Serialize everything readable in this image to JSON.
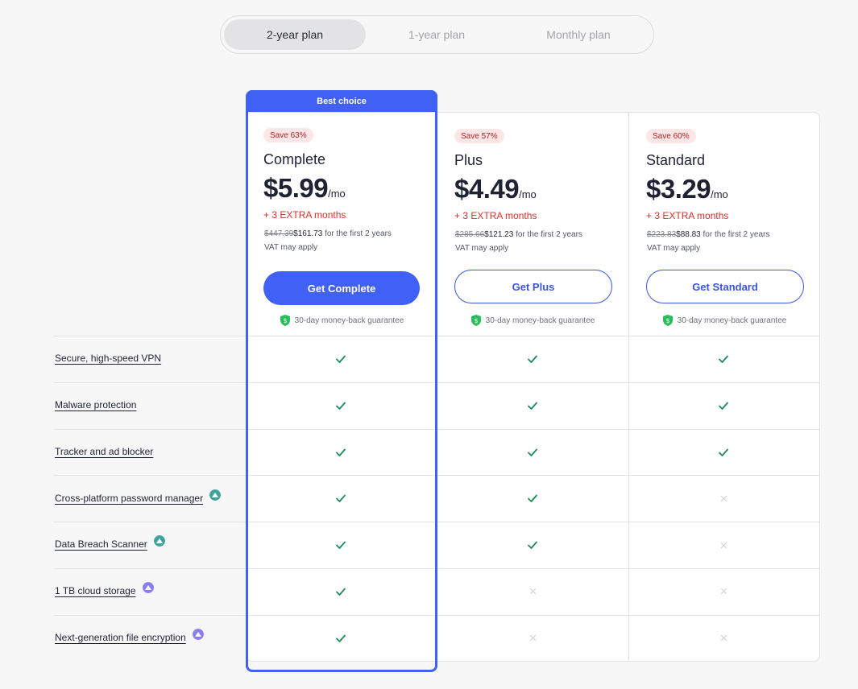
{
  "toggle": {
    "options": [
      "2-year plan",
      "1-year plan",
      "Monthly plan"
    ],
    "selected": "2-year plan"
  },
  "best_choice_label": "Best choice",
  "plans": [
    {
      "badge": "Save 63%",
      "name": "Complete",
      "price": "$5.99",
      "per": "/mo",
      "extra": "+ 3 EXTRA months",
      "old_price": "$447.39",
      "new_price": "$161.73",
      "period": " for the first 2 years",
      "vat": "VAT may apply",
      "cta": "Get Complete",
      "guarantee": "30-day money-back guarantee"
    },
    {
      "badge": "Save 57%",
      "name": "Plus",
      "price": "$4.49",
      "per": "/mo",
      "extra": "+ 3 EXTRA months",
      "old_price": "$285.66",
      "new_price": "$121.23",
      "period": " for the first 2 years",
      "vat": "VAT may apply",
      "cta": "Get Plus",
      "guarantee": "30-day money-back guarantee"
    },
    {
      "badge": "Save 60%",
      "name": "Standard",
      "price": "$3.29",
      "per": "/mo",
      "extra": "+ 3 EXTRA months",
      "old_price": "$223.83",
      "new_price": "$88.83",
      "period": " for the first 2 years",
      "vat": "VAT may apply",
      "cta": "Get Standard",
      "guarantee": "30-day money-back guarantee"
    }
  ],
  "features": [
    {
      "label": "Secure, high-speed VPN",
      "icon": "",
      "availability": [
        true,
        true,
        true
      ]
    },
    {
      "label": "Malware protection",
      "icon": "",
      "availability": [
        true,
        true,
        true
      ]
    },
    {
      "label": "Tracker and ad blocker",
      "icon": "",
      "availability": [
        true,
        true,
        true
      ]
    },
    {
      "label": "Cross-platform password manager",
      "icon": "nordpass-icon",
      "availability": [
        true,
        true,
        false
      ]
    },
    {
      "label": "Data Breach Scanner",
      "icon": "nordpass-icon",
      "availability": [
        true,
        true,
        false
      ]
    },
    {
      "label": "1 TB cloud storage",
      "icon": "nordlocker-icon",
      "availability": [
        true,
        false,
        false
      ]
    },
    {
      "label": "Next-generation file encryption",
      "icon": "nordlocker-icon",
      "availability": [
        true,
        false,
        false
      ]
    }
  ],
  "colors": {
    "accent": "#4160f6",
    "check": "#1e8a5a",
    "cross": "#cfd0d6",
    "extra_red": "#d6302c",
    "badge_bg": "#fde6e6",
    "shield_green": "#2bbd5c",
    "nordpass_teal": "#3fa3a0",
    "nordlocker_purple": "#8a7ff0"
  }
}
